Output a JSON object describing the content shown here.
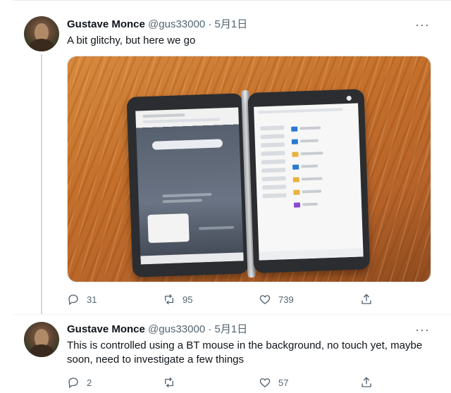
{
  "tweets": [
    {
      "author": {
        "name": "Gustave Monce",
        "handle": "@gus33000",
        "separator": "·",
        "time": "5月1日"
      },
      "text": "A bit glitchy, but here we go",
      "more": "···",
      "media": {
        "alt_icon": "photo-dual-screen-device"
      },
      "stats": {
        "replies": "31",
        "retweets": "95",
        "likes": "739",
        "share": ""
      }
    },
    {
      "author": {
        "name": "Gustave Monce",
        "handle": "@gus33000",
        "separator": "·",
        "time": "5月1日"
      },
      "text": "This is controlled using a BT mouse in the background, no touch yet, maybe soon, need to investigate a few things",
      "more": "···",
      "stats": {
        "replies": "2",
        "retweets": "",
        "likes": "57",
        "share": ""
      }
    }
  ],
  "colors": {
    "text": "#0f1419",
    "secondary": "#536471",
    "border": "#eff3f4",
    "thread": "#cfd9de"
  },
  "icons": [
    "reply-icon",
    "retweet-icon",
    "like-icon",
    "share-icon",
    "more-icon"
  ]
}
